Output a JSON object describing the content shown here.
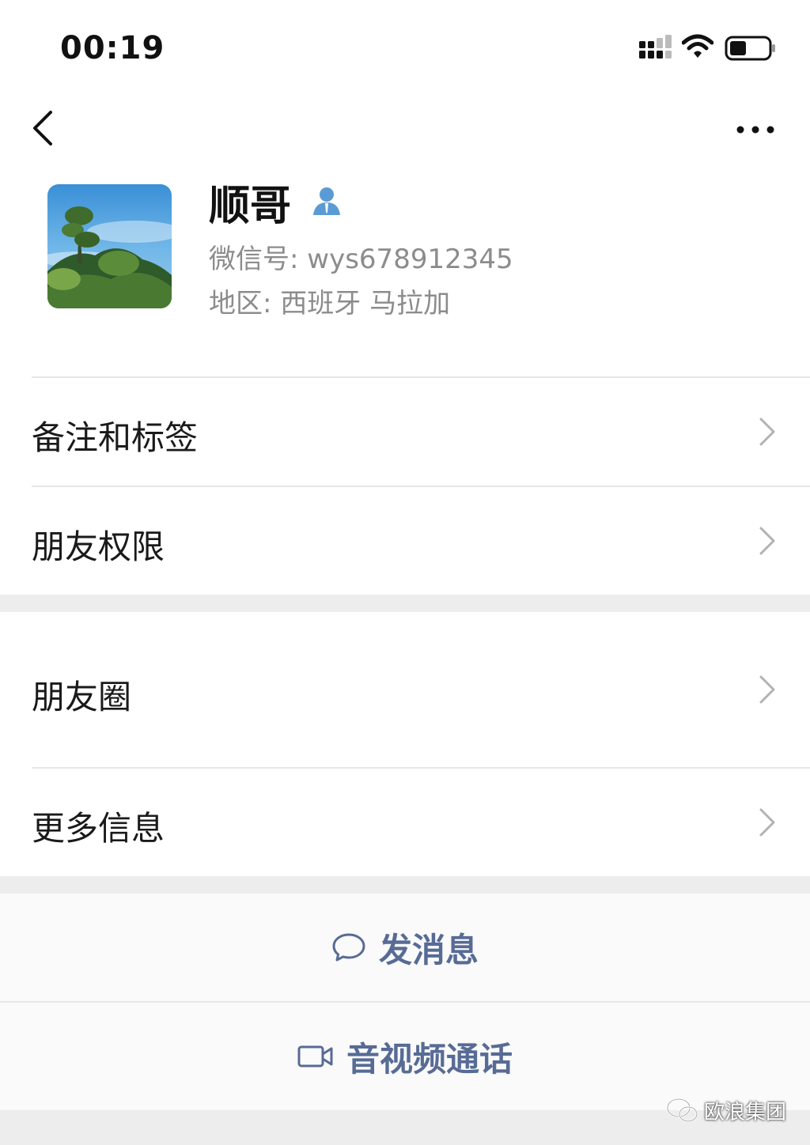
{
  "status_bar": {
    "time": "00:19",
    "icons": [
      "signal-icon",
      "wifi-icon",
      "battery-icon"
    ]
  },
  "nav": {
    "back_icon": "chevron-left-icon",
    "more_icon": "more-dots-icon"
  },
  "profile": {
    "name": "顺哥",
    "contact_icon": "contact-person-icon",
    "wechat_id_label": "微信号:",
    "wechat_id": "wys678912345",
    "region_label": "地区:",
    "region_value": "西班牙 马拉加"
  },
  "menu": {
    "items": [
      {
        "label": "备注和标签"
      },
      {
        "label": "朋友权限"
      },
      {
        "label": "朋友圈"
      },
      {
        "label": "更多信息"
      }
    ]
  },
  "actions": {
    "message": {
      "label": "发消息",
      "icon": "chat-bubble-icon"
    },
    "call": {
      "label": "音视频通话",
      "icon": "video-camera-icon"
    }
  },
  "watermark": {
    "text": "欧浪集团",
    "icon": "wechat-logo-icon"
  },
  "colors": {
    "link_blue": "#576b95",
    "secondary_text": "#8c8c8c",
    "section_gap": "#ededed",
    "contact_icon": "#5b9bd5"
  }
}
